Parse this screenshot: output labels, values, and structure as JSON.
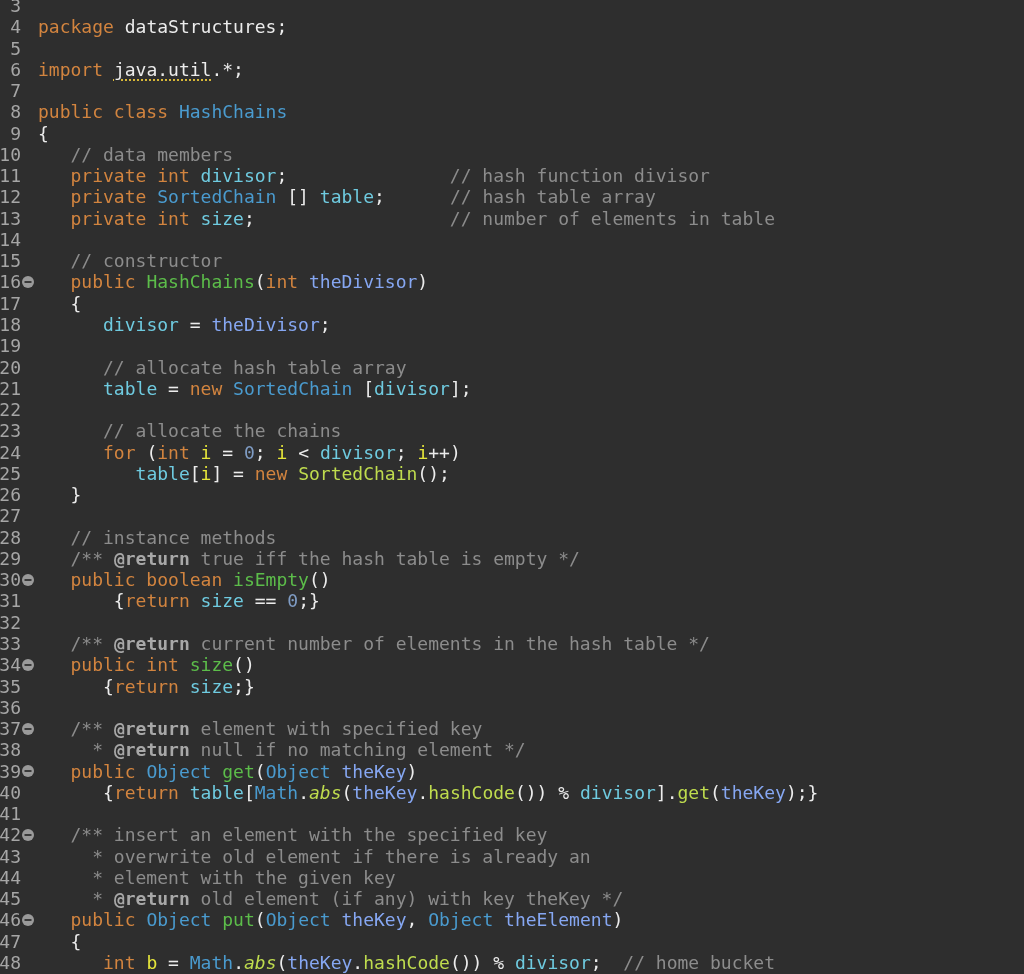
{
  "editor": {
    "lines": [
      {
        "number": "3",
        "foldable": false
      },
      {
        "number": "4",
        "foldable": false,
        "code": [
          {
            "text": "package",
            "kind": "keyword"
          },
          {
            "text": " dataStructures;",
            "kind": "plain"
          }
        ]
      },
      {
        "number": "5",
        "foldable": false
      },
      {
        "number": "6",
        "foldable": false,
        "code": [
          {
            "text": "import",
            "kind": "keyword"
          },
          {
            "text": " java.util",
            "kind": "warning"
          },
          {
            "text": ".*;",
            "kind": "plain"
          }
        ]
      },
      {
        "number": "7",
        "foldable": false
      },
      {
        "number": "8",
        "foldable": false,
        "code": [
          {
            "text": "public class",
            "kind": "keyword"
          },
          {
            "text": " HashChains",
            "kind": "type"
          }
        ]
      },
      {
        "number": "9",
        "foldable": false,
        "code": [
          {
            "text": "{",
            "kind": "plain"
          }
        ]
      },
      {
        "number": "10",
        "foldable": false,
        "code": [
          {
            "text": "   // data members",
            "kind": "comment"
          }
        ]
      },
      {
        "number": "11",
        "foldable": false,
        "code": [
          {
            "text": "   private int",
            "kind": "keyword"
          },
          {
            "text": " divisor",
            "kind": "field"
          },
          {
            "text": ";",
            "kind": "plain"
          },
          {
            "text": "               // hash function divisor",
            "kind": "comment"
          }
        ]
      },
      {
        "number": "12",
        "foldable": false,
        "code": [
          {
            "text": "   private",
            "kind": "keyword"
          },
          {
            "text": " SortedChain",
            "kind": "type"
          },
          {
            "text": " []",
            "kind": "plain"
          },
          {
            "text": " table",
            "kind": "field"
          },
          {
            "text": ";",
            "kind": "plain"
          },
          {
            "text": "      // hash table array",
            "kind": "comment"
          }
        ]
      },
      {
        "number": "13",
        "foldable": false,
        "code": [
          {
            "text": "   private int",
            "kind": "keyword"
          },
          {
            "text": " size",
            "kind": "field"
          },
          {
            "text": ";",
            "kind": "plain"
          },
          {
            "text": "                  // number of elements in table",
            "kind": "comment"
          }
        ]
      },
      {
        "number": "14",
        "foldable": false
      },
      {
        "number": "15",
        "foldable": false,
        "code": [
          {
            "text": "   // constructor",
            "kind": "comment"
          }
        ]
      },
      {
        "number": "16",
        "foldable": true,
        "code": [
          {
            "text": "   public",
            "kind": "keyword"
          },
          {
            "text": " HashChains",
            "kind": "method"
          },
          {
            "text": "(",
            "kind": "plain"
          },
          {
            "text": "int",
            "kind": "keyword"
          },
          {
            "text": " theDivisor",
            "kind": "param"
          },
          {
            "text": ")",
            "kind": "plain"
          }
        ]
      },
      {
        "number": "17",
        "foldable": false,
        "code": [
          {
            "text": "   {",
            "kind": "plain"
          }
        ]
      },
      {
        "number": "18",
        "foldable": false,
        "code": [
          {
            "text": "      divisor",
            "kind": "field"
          },
          {
            "text": " = ",
            "kind": "plain"
          },
          {
            "text": "theDivisor",
            "kind": "param"
          },
          {
            "text": ";",
            "kind": "plain"
          }
        ]
      },
      {
        "number": "19",
        "foldable": false
      },
      {
        "number": "20",
        "foldable": false,
        "code": [
          {
            "text": "      // allocate hash table array",
            "kind": "comment"
          }
        ]
      },
      {
        "number": "21",
        "foldable": false,
        "code": [
          {
            "text": "      table",
            "kind": "field"
          },
          {
            "text": " = ",
            "kind": "plain"
          },
          {
            "text": "new",
            "kind": "keyword"
          },
          {
            "text": " SortedChain",
            "kind": "type"
          },
          {
            "text": " [",
            "kind": "plain"
          },
          {
            "text": "divisor",
            "kind": "field"
          },
          {
            "text": "];",
            "kind": "plain"
          }
        ]
      },
      {
        "number": "22",
        "foldable": false
      },
      {
        "number": "23",
        "foldable": false,
        "code": [
          {
            "text": "      // allocate the chains",
            "kind": "comment"
          }
        ]
      },
      {
        "number": "24",
        "foldable": false,
        "code": [
          {
            "text": "      for",
            "kind": "keyword"
          },
          {
            "text": " (",
            "kind": "plain"
          },
          {
            "text": "int",
            "kind": "keyword"
          },
          {
            "text": " i",
            "kind": "local"
          },
          {
            "text": " = ",
            "kind": "plain"
          },
          {
            "text": "0",
            "kind": "number"
          },
          {
            "text": "; ",
            "kind": "plain"
          },
          {
            "text": "i",
            "kind": "local"
          },
          {
            "text": " < ",
            "kind": "plain"
          },
          {
            "text": "divisor",
            "kind": "field"
          },
          {
            "text": "; ",
            "kind": "plain"
          },
          {
            "text": "i",
            "kind": "local"
          },
          {
            "text": "++)",
            "kind": "plain"
          }
        ]
      },
      {
        "number": "25",
        "foldable": false,
        "code": [
          {
            "text": "         table",
            "kind": "field"
          },
          {
            "text": "[",
            "kind": "plain"
          },
          {
            "text": "i",
            "kind": "local"
          },
          {
            "text": "] = ",
            "kind": "plain"
          },
          {
            "text": "new",
            "kind": "keyword"
          },
          {
            "text": " SortedChain",
            "kind": "call"
          },
          {
            "text": "();",
            "kind": "plain"
          }
        ]
      },
      {
        "number": "26",
        "foldable": false,
        "code": [
          {
            "text": "   }",
            "kind": "plain"
          }
        ]
      },
      {
        "number": "27",
        "foldable": false
      },
      {
        "number": "28",
        "foldable": false,
        "code": [
          {
            "text": "   // instance methods",
            "kind": "comment"
          }
        ]
      },
      {
        "number": "29",
        "foldable": false,
        "code": [
          {
            "text": "   /**",
            "kind": "doc"
          },
          {
            "text": " @return",
            "kind": "tag"
          },
          {
            "text": " true iff the hash table is empty */",
            "kind": "doc"
          }
        ]
      },
      {
        "number": "30",
        "foldable": true,
        "code": [
          {
            "text": "   public boolean",
            "kind": "keyword"
          },
          {
            "text": " isEmpty",
            "kind": "method"
          },
          {
            "text": "()",
            "kind": "plain"
          }
        ]
      },
      {
        "number": "31",
        "foldable": false,
        "code": [
          {
            "text": "       {",
            "kind": "plain"
          },
          {
            "text": "return",
            "kind": "keyword"
          },
          {
            "text": " size",
            "kind": "field"
          },
          {
            "text": " == ",
            "kind": "plain"
          },
          {
            "text": "0",
            "kind": "number"
          },
          {
            "text": ";}",
            "kind": "plain"
          }
        ]
      },
      {
        "number": "32",
        "foldable": false
      },
      {
        "number": "33",
        "foldable": false,
        "code": [
          {
            "text": "   /**",
            "kind": "doc"
          },
          {
            "text": " @return",
            "kind": "tag"
          },
          {
            "text": " current number of elements in the hash table */",
            "kind": "doc"
          }
        ]
      },
      {
        "number": "34",
        "foldable": true,
        "code": [
          {
            "text": "   public int",
            "kind": "keyword"
          },
          {
            "text": " size",
            "kind": "method"
          },
          {
            "text": "()",
            "kind": "plain"
          }
        ]
      },
      {
        "number": "35",
        "foldable": false,
        "code": [
          {
            "text": "      {",
            "kind": "plain"
          },
          {
            "text": "return",
            "kind": "keyword"
          },
          {
            "text": " size",
            "kind": "field"
          },
          {
            "text": ";}",
            "kind": "plain"
          }
        ]
      },
      {
        "number": "36",
        "foldable": false
      },
      {
        "number": "37",
        "foldable": true,
        "code": [
          {
            "text": "   /**",
            "kind": "doc"
          },
          {
            "text": " @return",
            "kind": "tag"
          },
          {
            "text": " element with specified key",
            "kind": "doc"
          }
        ]
      },
      {
        "number": "38",
        "foldable": false,
        "code": [
          {
            "text": "     *",
            "kind": "doc"
          },
          {
            "text": " @return",
            "kind": "tag"
          },
          {
            "text": " null if no matching element */",
            "kind": "doc"
          }
        ]
      },
      {
        "number": "39",
        "foldable": true,
        "code": [
          {
            "text": "   public",
            "kind": "keyword"
          },
          {
            "text": " Object",
            "kind": "type"
          },
          {
            "text": " get",
            "kind": "method"
          },
          {
            "text": "(",
            "kind": "plain"
          },
          {
            "text": "Object",
            "kind": "type"
          },
          {
            "text": " theKey",
            "kind": "param"
          },
          {
            "text": ")",
            "kind": "plain"
          }
        ]
      },
      {
        "number": "40",
        "foldable": false,
        "code": [
          {
            "text": "      {",
            "kind": "plain"
          },
          {
            "text": "return",
            "kind": "keyword"
          },
          {
            "text": " table",
            "kind": "field"
          },
          {
            "text": "[",
            "kind": "plain"
          },
          {
            "text": "Math",
            "kind": "type"
          },
          {
            "text": ".",
            "kind": "plain"
          },
          {
            "text": "abs",
            "kind": "static"
          },
          {
            "text": "(",
            "kind": "plain"
          },
          {
            "text": "theKey",
            "kind": "param"
          },
          {
            "text": ".",
            "kind": "plain"
          },
          {
            "text": "hashCode",
            "kind": "call"
          },
          {
            "text": "()) % ",
            "kind": "plain"
          },
          {
            "text": "divisor",
            "kind": "field"
          },
          {
            "text": "].",
            "kind": "plain"
          },
          {
            "text": "get",
            "kind": "call"
          },
          {
            "text": "(",
            "kind": "plain"
          },
          {
            "text": "theKey",
            "kind": "param"
          },
          {
            "text": ");}",
            "kind": "plain"
          }
        ]
      },
      {
        "number": "41",
        "foldable": false
      },
      {
        "number": "42",
        "foldable": true,
        "code": [
          {
            "text": "   /** insert an element with the specified key",
            "kind": "doc"
          }
        ]
      },
      {
        "number": "43",
        "foldable": false,
        "code": [
          {
            "text": "     * overwrite old element if there is already an",
            "kind": "doc"
          }
        ]
      },
      {
        "number": "44",
        "foldable": false,
        "code": [
          {
            "text": "     * element with the given key",
            "kind": "doc"
          }
        ]
      },
      {
        "number": "45",
        "foldable": false,
        "code": [
          {
            "text": "     *",
            "kind": "doc"
          },
          {
            "text": " @return",
            "kind": "tag"
          },
          {
            "text": " old element (if any) with key theKey */",
            "kind": "doc"
          }
        ]
      },
      {
        "number": "46",
        "foldable": true,
        "code": [
          {
            "text": "   public",
            "kind": "keyword"
          },
          {
            "text": " Object",
            "kind": "type"
          },
          {
            "text": " put",
            "kind": "method"
          },
          {
            "text": "(",
            "kind": "plain"
          },
          {
            "text": "Object",
            "kind": "type"
          },
          {
            "text": " theKey",
            "kind": "param"
          },
          {
            "text": ", ",
            "kind": "plain"
          },
          {
            "text": "Object",
            "kind": "type"
          },
          {
            "text": " theElement",
            "kind": "param"
          },
          {
            "text": ")",
            "kind": "plain"
          }
        ]
      },
      {
        "number": "47",
        "foldable": false,
        "code": [
          {
            "text": "   {",
            "kind": "plain"
          }
        ]
      },
      {
        "number": "48",
        "foldable": false,
        "code": [
          {
            "text": "      int",
            "kind": "keyword"
          },
          {
            "text": " b",
            "kind": "local"
          },
          {
            "text": " = ",
            "kind": "plain"
          },
          {
            "text": "Math",
            "kind": "type"
          },
          {
            "text": ".",
            "kind": "plain"
          },
          {
            "text": "abs",
            "kind": "static"
          },
          {
            "text": "(",
            "kind": "plain"
          },
          {
            "text": "theKey",
            "kind": "param"
          },
          {
            "text": ".",
            "kind": "plain"
          },
          {
            "text": "hashCode",
            "kind": "call"
          },
          {
            "text": "()) % ",
            "kind": "plain"
          },
          {
            "text": "divisor",
            "kind": "field"
          },
          {
            "text": ";",
            "kind": "plain"
          },
          {
            "text": "  // home bucket",
            "kind": "comment"
          }
        ]
      }
    ]
  }
}
